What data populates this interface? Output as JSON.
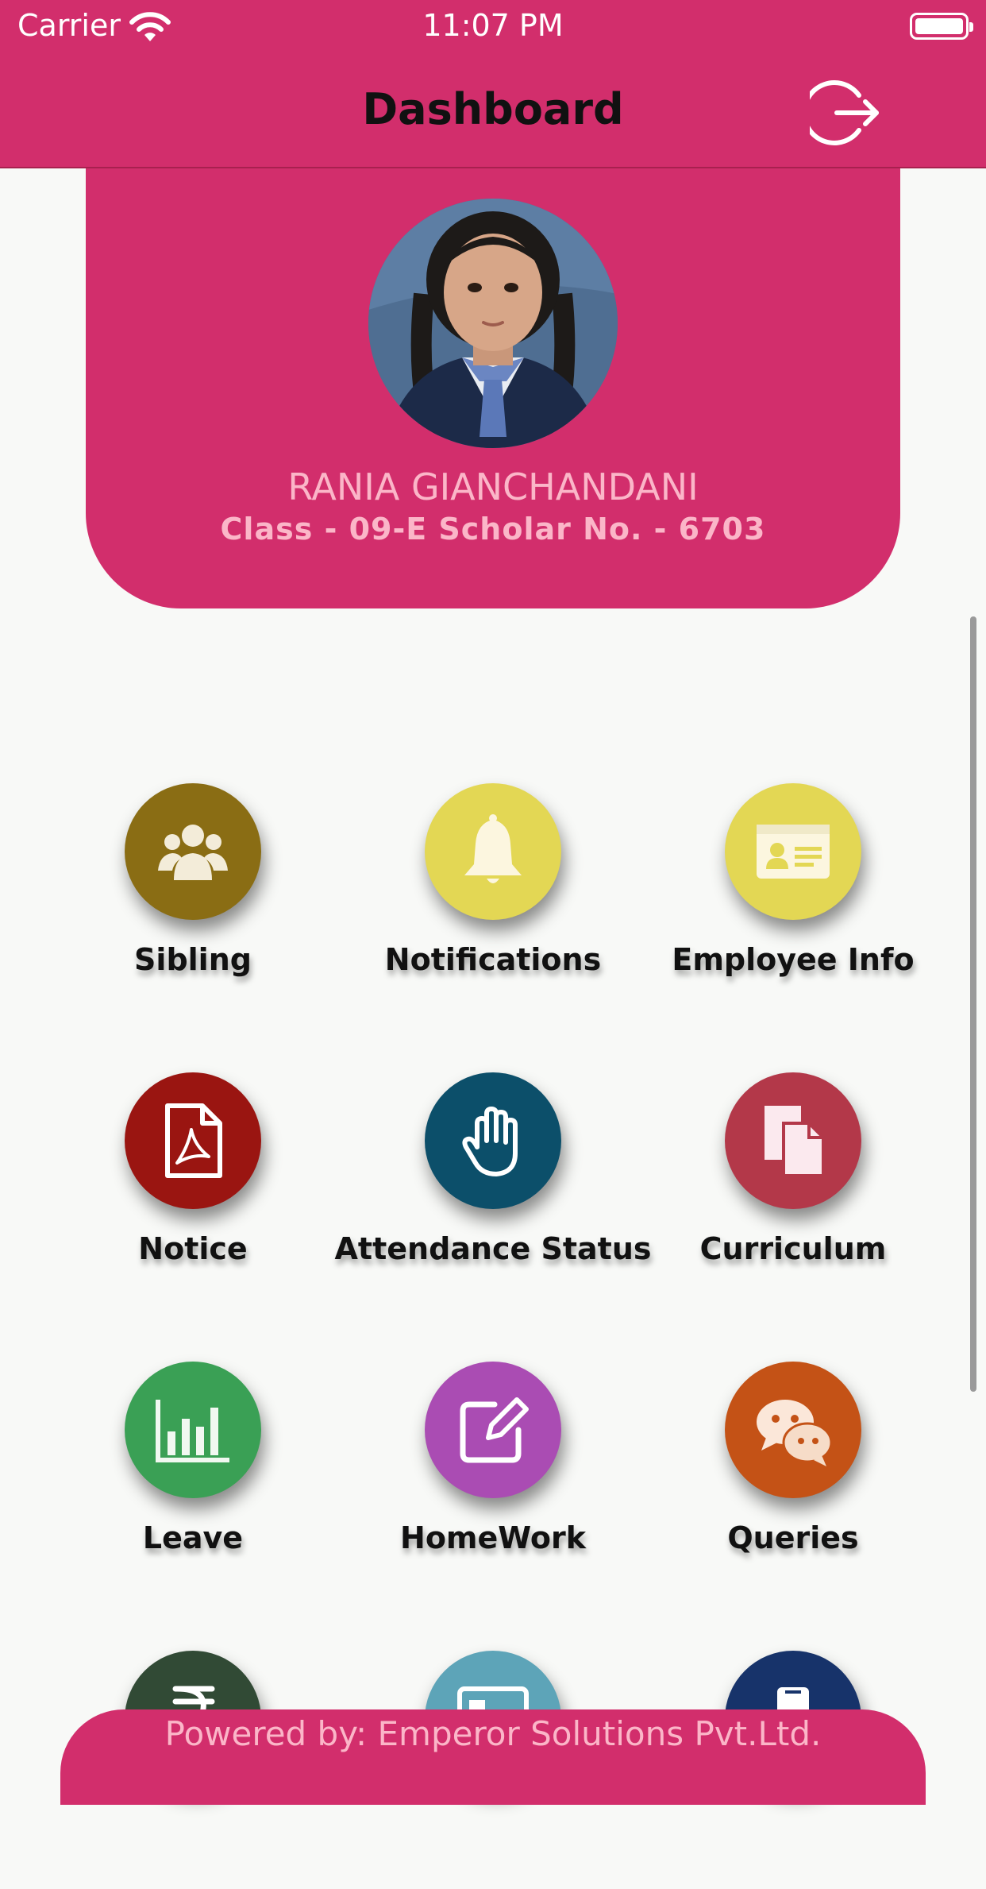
{
  "status_bar": {
    "carrier": "Carrier",
    "time": "11:07 PM"
  },
  "header": {
    "title": "Dashboard",
    "logout_icon": "logout-icon"
  },
  "profile": {
    "name": "RANIA GIANCHANDANI",
    "meta": "Class - 09-E Scholar No. - 6703"
  },
  "menu": [
    {
      "label": "Sibling",
      "icon": "group-icon",
      "color": "#8a6d14"
    },
    {
      "label": "Notifications",
      "icon": "bell-icon",
      "color": "#e3d754"
    },
    {
      "label": "Employee Info",
      "icon": "id-card-icon",
      "color": "#e3d754"
    },
    {
      "label": "Notice",
      "icon": "pdf-file-icon",
      "color": "#9a1511"
    },
    {
      "label": "Attendance Status",
      "icon": "hand-icon",
      "color": "#0c4f6a"
    },
    {
      "label": "Curriculum",
      "icon": "documents-icon",
      "color": "#b33849"
    },
    {
      "label": "Leave",
      "icon": "bar-chart-icon",
      "color": "#3aa055"
    },
    {
      "label": "HomeWork",
      "icon": "edit-icon",
      "color": "#aa4cb3"
    },
    {
      "label": "Queries",
      "icon": "chat-icon",
      "color": "#c45216"
    },
    {
      "label": "",
      "icon": "rupee-icon",
      "color": "#314a35"
    },
    {
      "label": "",
      "icon": "card-icon",
      "color": "#5da4b8"
    },
    {
      "label": "",
      "icon": "mobile-icon",
      "color": "#17336a"
    }
  ],
  "footer": {
    "text": "Powered by: Emperor Solutions Pvt.Ltd."
  }
}
